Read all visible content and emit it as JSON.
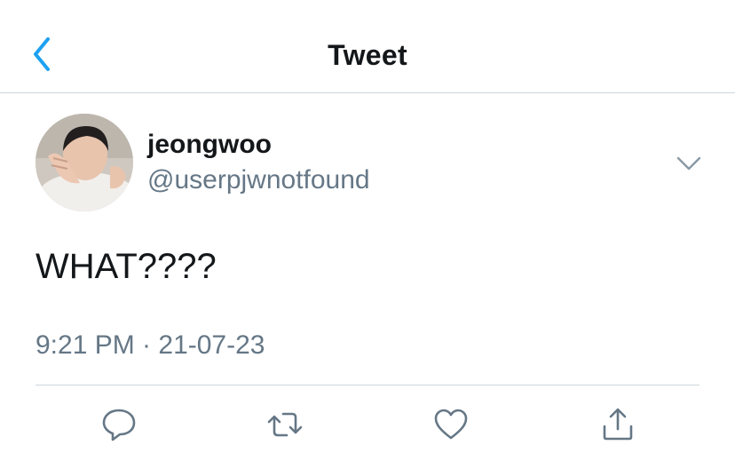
{
  "header": {
    "title": "Tweet",
    "back_icon": "chevron-left-icon",
    "accent_color": "#1da1f2"
  },
  "tweet": {
    "display_name": "jeongwoo",
    "handle": "@userpjwnotfound",
    "text": "WHAT????",
    "timestamp": "9:21 PM · 21-07-23",
    "more_icon": "chevron-down-icon"
  },
  "actions": [
    {
      "name": "reply",
      "icon": "reply-icon"
    },
    {
      "name": "retweet",
      "icon": "retweet-icon"
    },
    {
      "name": "like",
      "icon": "heart-icon"
    },
    {
      "name": "share",
      "icon": "share-icon"
    }
  ],
  "colors": {
    "text": "#14171a",
    "secondary_text": "#657786",
    "divider": "#ccd6dd"
  }
}
